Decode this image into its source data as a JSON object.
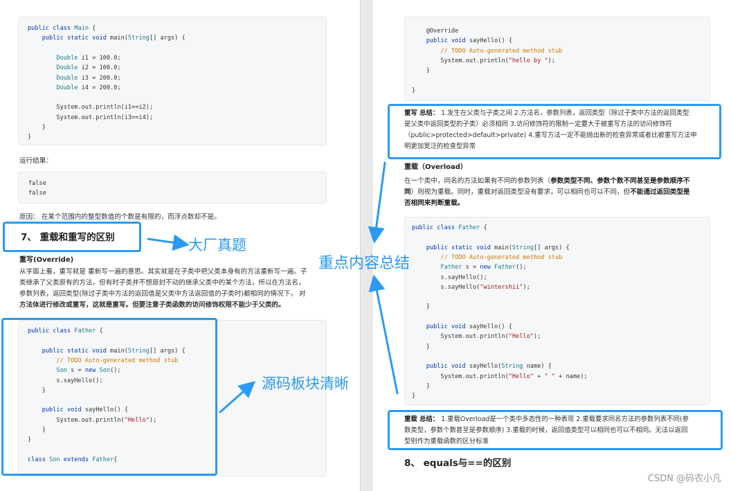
{
  "left": {
    "code1": [
      "public class Main {",
      "    public static void main(String[] args) {",
      "",
      "        Double i1 = 100.0;",
      "        Double i2 = 100.0;",
      "        Double i3 = 200.0;",
      "        Double i4 = 200.0;",
      "",
      "        System.out.println(i1==i2);",
      "        System.out.println(i3==i4);",
      "    }",
      "}"
    ],
    "result_label": "运行结果：",
    "output": [
      "false",
      "false"
    ],
    "reason": "原因： 在某个范围内的整型数值的个数是有限的，而浮点数却不是。",
    "section7_title": "7、 重载和重写的区别",
    "override_title": "重写(Override)",
    "override_para": [
      "从字面上看，重写就是 重新写一遍的意思。其实就是在子类中把父类本身有的方法重新写一遍。子",
      "类继承了父类原有的方法，但有时子类并不想原封不动的继承父类中的某个方法，所以在方法名，",
      "参数列表，返回类型(除过子类中方法的返回值是父类中方法返回值的子类时)都相同的情况下， 对",
      "方法体进行修改或重写，这就是重写。但要注意子类函数的访问修饰权限不能少于父类的。"
    ],
    "code2": [
      "public class Father {",
      "",
      "    public static void main(String[] args) {",
      "        // TODO Auto-generated method stub",
      "        Son s = new Son();",
      "        s.sayHello();",
      "    }",
      "",
      "    public void sayHello() {",
      "        System.out.println(\"Hello\");",
      "    }",
      "}",
      "",
      "class Son extends Father{"
    ]
  },
  "right": {
    "code_top": [
      "    @Override",
      "    public void sayHello() {",
      "        // TODO Auto-generated method stub",
      "        System.out.println(\"hello by \");",
      "    }",
      "",
      "}"
    ],
    "override_summary_label": "重写 总结：",
    "override_summary": [
      " 1.发生在父类与子类之间 2.方法名，参数列表，返回类型（除过子类中方法的返回类型",
      "是父类中返回类型的子类）必须相同 3.访问修饰符的限制一定要大于被重写方法的访问修饰符",
      "（public>protected>default>private) 4.重写方法一定不能抛出新的检查异常或者比被重写方法申",
      "明更加宽泛的检查型异常"
    ],
    "overload_title": "重载（Overload）",
    "overload_para": {
      "line1_a": "在一个类中，同名的方法如果有不同的参数列表（",
      "line1_b": "参数类型不同、参数个数不同甚至是参数顺序不",
      "line2_a": "同",
      "line2_b": "）则视为重载。同时，重载对返回类型没有要求，可以相同也可以不同，但",
      "line2_c": "不能通过返回类型是",
      "line3": "否相同来判断重载。"
    },
    "code_mid": [
      "public class Father {",
      "",
      "    public static void main(String[] args) {",
      "        // TODO Auto-generated method stub",
      "        Father s = new Father();",
      "        s.sayHello();",
      "        s.sayHello(\"wintershii\");",
      "",
      "    }",
      "",
      "    public void sayHello() {",
      "        System.out.println(\"Hello\");",
      "    }",
      "",
      "    public void sayHello(String name) {",
      "        System.out.println(\"Hello\" + \" \" + name);",
      "    }",
      "}"
    ],
    "overload_summary_label": "重载 总结：",
    "overload_summary": [
      " 1.重载Overload是一个类中多态性的一种表现 2.重载要求同名方法的参数列表不同(参",
      "数类型，参数个数甚至是参数顺序) 3.重载的时候，返回值类型可以相同也可以不相同。无法以返回",
      "型别作为重载函数的区分标准"
    ],
    "section8_title": "8、 equals与==的区别"
  },
  "annotations": {
    "interview": "大厂真题",
    "summary": "重点内容总结",
    "clear_code": "源码板块清晰"
  },
  "watermark": "CSDN @码农小凡",
  "colors": {
    "annotation_blue": "#2b9af3",
    "keyword": "#0033b3",
    "comment": "#cc7a00",
    "string": "#a31515"
  }
}
